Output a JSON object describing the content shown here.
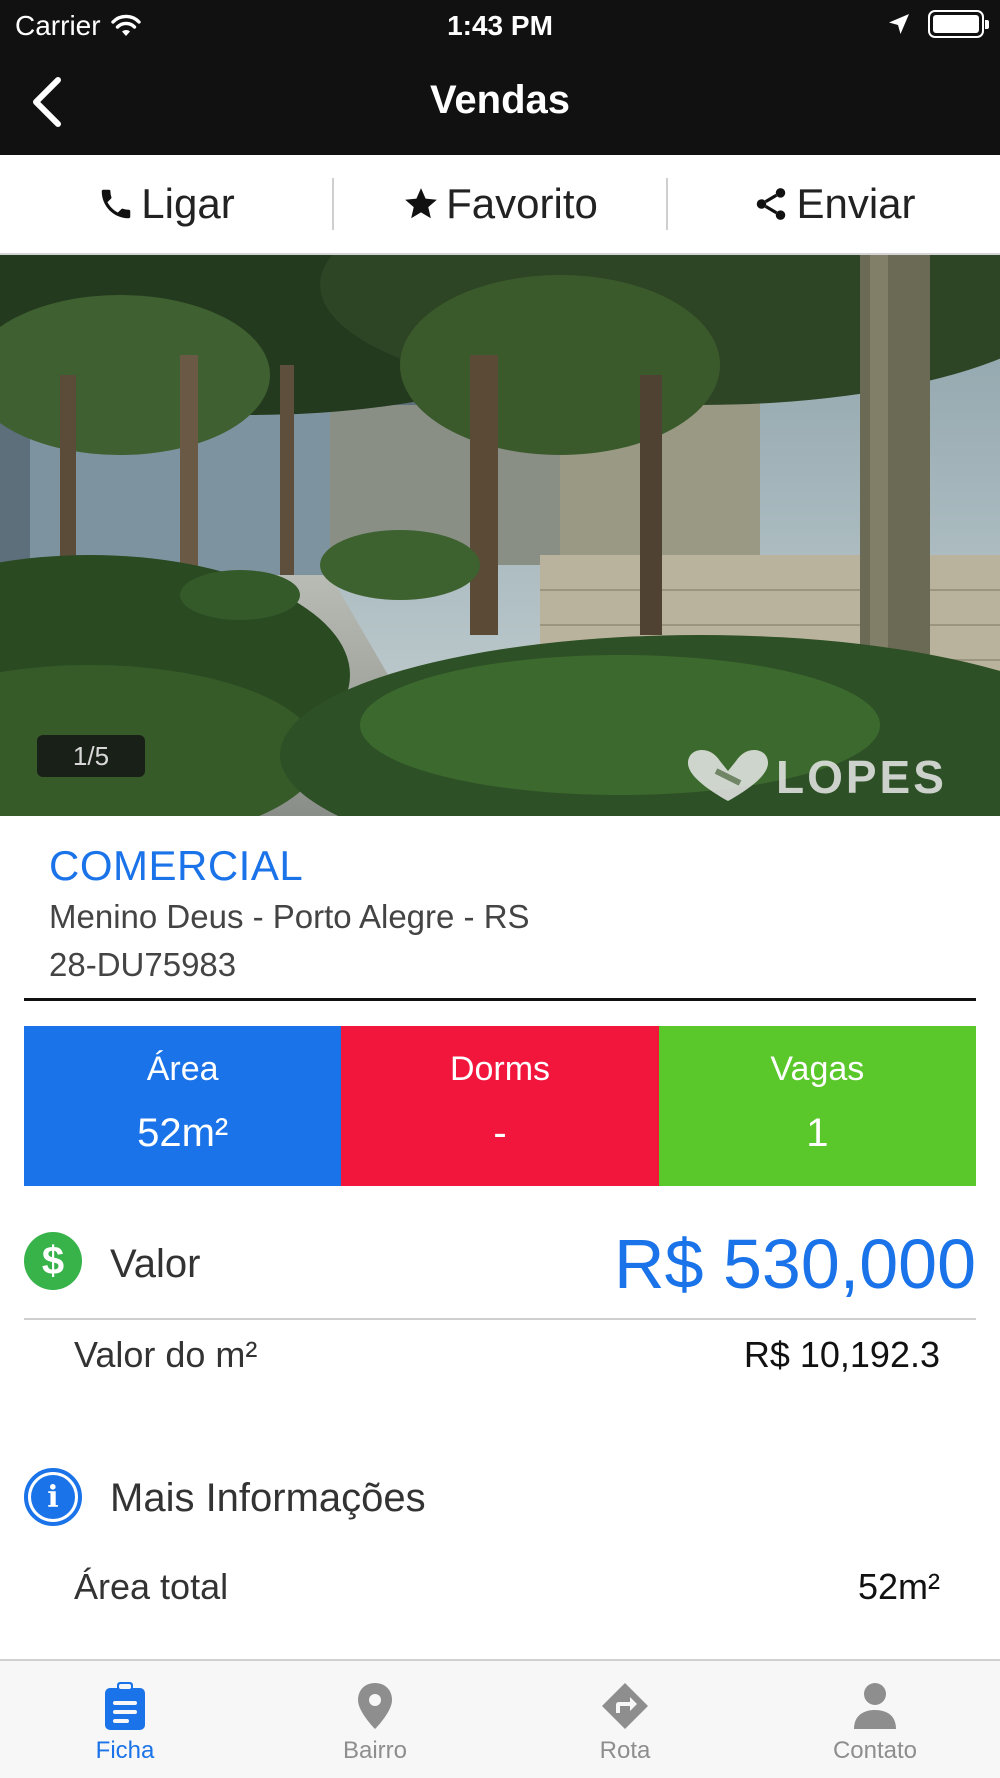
{
  "status_bar": {
    "carrier": "Carrier",
    "time": "1:43 PM"
  },
  "nav": {
    "title": "Vendas",
    "back_icon": "chevron-left-icon"
  },
  "actions": [
    {
      "label": "Ligar",
      "icon": "phone-icon"
    },
    {
      "label": "Favorito",
      "icon": "star-icon"
    },
    {
      "label": "Enviar",
      "icon": "share-icon"
    }
  ],
  "gallery": {
    "counter": "1/5",
    "watermark": "LOPES"
  },
  "property": {
    "type": "COMERCIAL",
    "location": "Menino Deus - Porto Alegre - RS",
    "code": "28-DU75983"
  },
  "features": [
    {
      "label": "Área",
      "value": "52m²",
      "color": "#1a73e8"
    },
    {
      "label": "Dorms",
      "value": "-",
      "color": "#f2163d"
    },
    {
      "label": "Vagas",
      "value": "1",
      "color": "#5ac72a"
    }
  ],
  "price": {
    "label": "Valor",
    "value": "R$ 530,000",
    "per_m2_label": "Valor do m²",
    "per_m2_value": "R$ 10,192.3"
  },
  "more_info": {
    "title": "Mais Informações",
    "rows": [
      {
        "label": "Área total",
        "value": "52m²"
      }
    ]
  },
  "tabs": [
    {
      "label": "Ficha",
      "icon": "clipboard-icon",
      "active": true
    },
    {
      "label": "Bairro",
      "icon": "map-pin-icon",
      "active": false
    },
    {
      "label": "Rota",
      "icon": "directions-icon",
      "active": false
    },
    {
      "label": "Contato",
      "icon": "person-icon",
      "active": false
    }
  ],
  "colors": {
    "accent": "#1a73e8",
    "money_icon": "#37b34a",
    "topbar": "#111111"
  }
}
